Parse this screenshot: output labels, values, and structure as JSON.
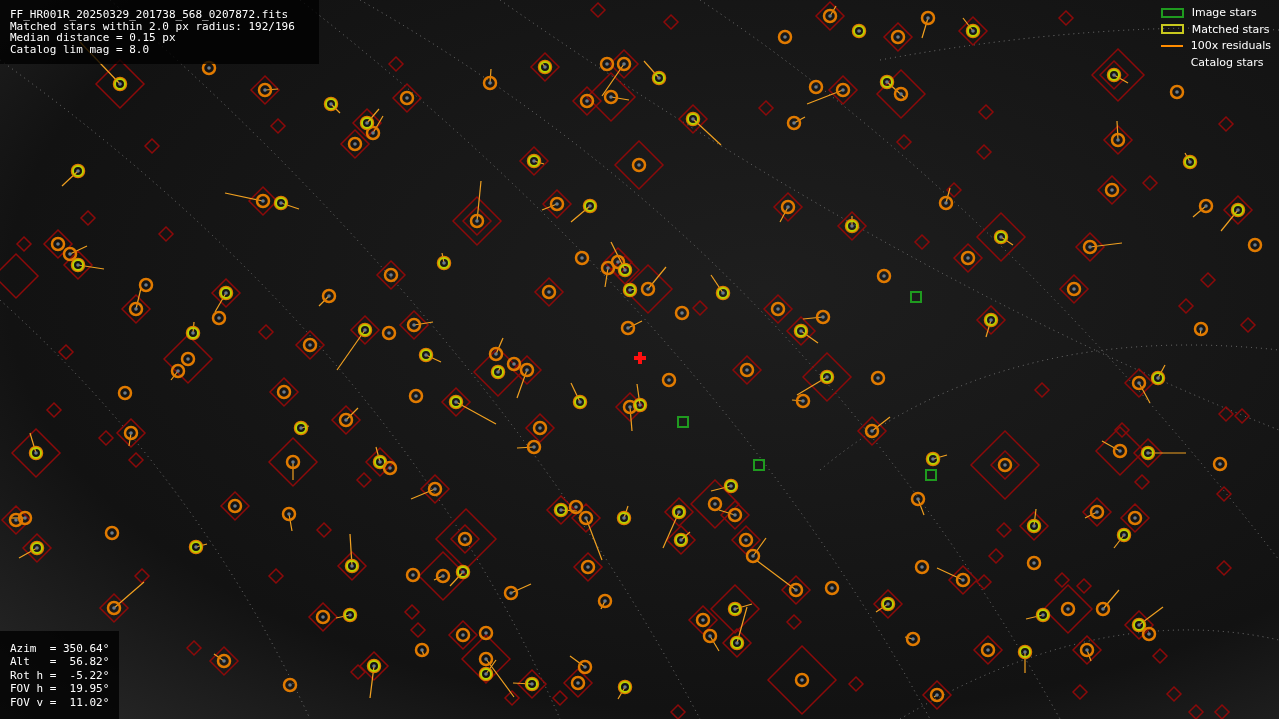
{
  "info": {
    "lines": [
      "FF_HR001R_20250329_201738_568_0207872.fits",
      "Matched stars within 2.0 px radius: 192/196",
      "Median distance = 0.15 px",
      "Catalog lim mag = 8.0"
    ]
  },
  "legend": [
    {
      "kind": "box",
      "color": "#1f9a1f",
      "label": "Image stars"
    },
    {
      "kind": "box",
      "color": "#c8c81e",
      "label": "Matched stars"
    },
    {
      "kind": "line",
      "color": "#ff8c00",
      "label": "100x residuals"
    },
    {
      "kind": "none",
      "label": "Catalog stars"
    }
  ],
  "pointing": {
    "lines": [
      "Azim  = 350.64°",
      "Alt   =  56.82°",
      "Rot h =  -5.22°",
      "FOV h =  19.95°",
      "FOV v =  11.02°"
    ]
  }
}
